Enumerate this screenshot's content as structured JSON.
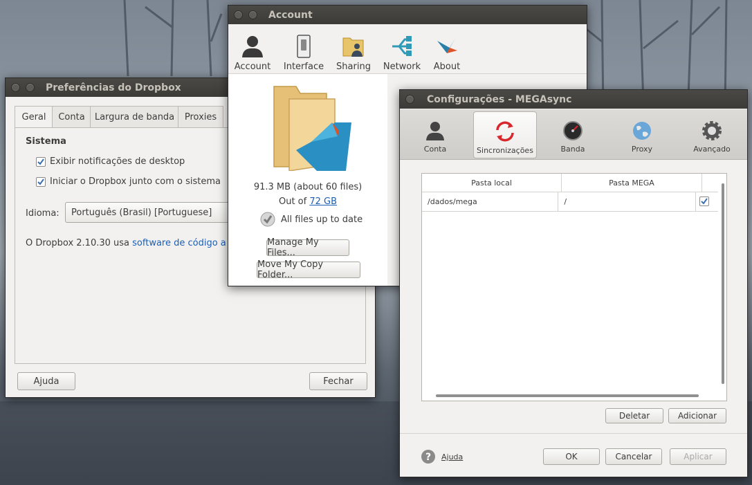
{
  "dropbox": {
    "title": "Preferências do Dropbox",
    "tabs": [
      "Geral",
      "Conta",
      "Largura de banda",
      "Proxies"
    ],
    "section": "Sistema",
    "options": [
      {
        "label": "Exibir notificações de desktop",
        "checked": true
      },
      {
        "label": "Iniciar o Dropbox junto com o sistema",
        "checked": true
      }
    ],
    "language_label": "Idioma:",
    "language_value": "Português (Brasil) [Portuguese]",
    "version_text": "O Dropbox 2.10.30 usa ",
    "version_link": "software de código abert",
    "help_button": "Ajuda",
    "close_button": "Fechar"
  },
  "account": {
    "title": "Account",
    "toolbar": [
      "Account",
      "Interface",
      "Sharing",
      "Network",
      "About"
    ],
    "usage": "91.3 MB (about 60 files)",
    "out_of": "Out of ",
    "quota": "72 GB",
    "status": "All files up to date",
    "manage_button": "Manage My Files...",
    "move_button": "Move My Copy Folder..."
  },
  "mega": {
    "title": "Configurações - MEGAsync",
    "toolbar": [
      "Conta",
      "Sincronizações",
      "Banda",
      "Proxy",
      "Avançado"
    ],
    "active_tab": "Sincronizações",
    "columns": [
      "Pasta local",
      "Pasta MEGA"
    ],
    "rows": [
      {
        "local": "/dados/mega",
        "remote": "/",
        "checked": true
      }
    ],
    "delete_button": "Deletar",
    "add_button": "Adicionar",
    "help_link": "Ajuda",
    "ok_button": "OK",
    "cancel_button": "Cancelar",
    "apply_button": "Aplicar"
  },
  "colors": {
    "accent_red": "#d9272e",
    "link": "#1a5fb4",
    "titlebar": "#3c3b37"
  }
}
